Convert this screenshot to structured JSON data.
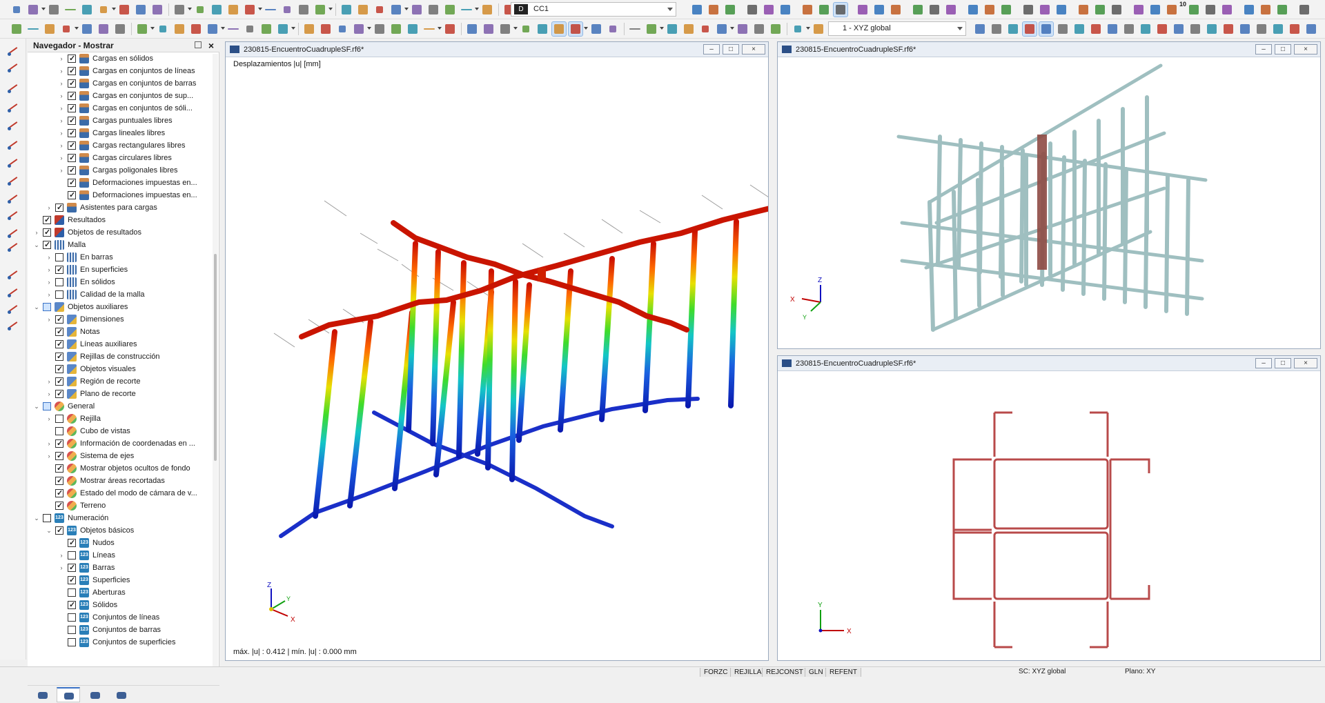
{
  "toolbar": {
    "design_situation_badge": "D",
    "load_case": "CC1",
    "coordinate_system": "1 - XYZ global",
    "scale_label": "10"
  },
  "navigator": {
    "title": "Navegador - Mostrar",
    "items": [
      {
        "label": "Cargas en sólidos",
        "level": 3,
        "checked": true,
        "icon": "load",
        "expander": true
      },
      {
        "label": "Cargas en conjuntos de líneas",
        "level": 3,
        "checked": true,
        "icon": "load",
        "expander": true
      },
      {
        "label": "Cargas en conjuntos de barras",
        "level": 3,
        "checked": true,
        "icon": "load",
        "expander": true
      },
      {
        "label": "Cargas en conjuntos de sup...",
        "level": 3,
        "checked": true,
        "icon": "load",
        "expander": true
      },
      {
        "label": "Cargas en conjuntos de sóli...",
        "level": 3,
        "checked": true,
        "icon": "load",
        "expander": true
      },
      {
        "label": "Cargas puntuales libres",
        "level": 3,
        "checked": true,
        "icon": "load",
        "expander": true
      },
      {
        "label": "Cargas lineales libres",
        "level": 3,
        "checked": true,
        "icon": "load",
        "expander": true
      },
      {
        "label": "Cargas rectangulares libres",
        "level": 3,
        "checked": true,
        "icon": "load",
        "expander": true
      },
      {
        "label": "Cargas circulares libres",
        "level": 3,
        "checked": true,
        "icon": "load",
        "expander": true
      },
      {
        "label": "Cargas poligonales libres",
        "level": 3,
        "checked": true,
        "icon": "load",
        "expander": true
      },
      {
        "label": "Deformaciones impuestas en...",
        "level": 3,
        "checked": true,
        "icon": "load",
        "expander": false
      },
      {
        "label": "Deformaciones impuestas en...",
        "level": 3,
        "checked": true,
        "icon": "load",
        "expander": false
      },
      {
        "label": "Asistentes para cargas",
        "level": 2,
        "checked": true,
        "icon": "load",
        "expander": true
      },
      {
        "label": "Resultados",
        "level": 1,
        "checked": true,
        "icon": "res",
        "expander": false
      },
      {
        "label": "Objetos de resultados",
        "level": 1,
        "checked": true,
        "icon": "res",
        "expander": true
      },
      {
        "label": "Malla",
        "level": 1,
        "checked": true,
        "icon": "mesh",
        "expander": "open"
      },
      {
        "label": "En barras",
        "level": 2,
        "checked": false,
        "icon": "mesh",
        "expander": true
      },
      {
        "label": "En superficies",
        "level": 2,
        "checked": true,
        "icon": "mesh",
        "expander": true
      },
      {
        "label": "En sólidos",
        "level": 2,
        "checked": false,
        "icon": "mesh",
        "expander": true
      },
      {
        "label": "Calidad de la malla",
        "level": 2,
        "checked": false,
        "icon": "mesh",
        "expander": true
      },
      {
        "label": "Objetos auxiliares",
        "level": 1,
        "checked": "partial",
        "icon": "aux",
        "expander": "open"
      },
      {
        "label": "Dimensiones",
        "level": 2,
        "checked": true,
        "icon": "aux",
        "expander": true
      },
      {
        "label": "Notas",
        "level": 2,
        "checked": true,
        "icon": "aux",
        "expander": false
      },
      {
        "label": "Líneas auxiliares",
        "level": 2,
        "checked": true,
        "icon": "aux",
        "expander": false
      },
      {
        "label": "Rejillas de construcción",
        "level": 2,
        "checked": true,
        "icon": "aux",
        "expander": false
      },
      {
        "label": "Objetos visuales",
        "level": 2,
        "checked": true,
        "icon": "aux",
        "expander": false
      },
      {
        "label": "Región de recorte",
        "level": 2,
        "checked": true,
        "icon": "aux",
        "expander": true
      },
      {
        "label": "Plano de recorte",
        "level": 2,
        "checked": true,
        "icon": "aux",
        "expander": true
      },
      {
        "label": "General",
        "level": 1,
        "checked": "partial",
        "icon": "gen",
        "expander": "open"
      },
      {
        "label": "Rejilla",
        "level": 2,
        "checked": false,
        "icon": "gen",
        "expander": true
      },
      {
        "label": "Cubo de vistas",
        "level": 2,
        "checked": false,
        "icon": "gen",
        "expander": false
      },
      {
        "label": "Información de coordenadas en ...",
        "level": 2,
        "checked": true,
        "icon": "gen",
        "expander": true
      },
      {
        "label": "Sistema de ejes",
        "level": 2,
        "checked": true,
        "icon": "gen",
        "expander": true
      },
      {
        "label": "Mostrar objetos ocultos de fondo",
        "level": 2,
        "checked": true,
        "icon": "gen",
        "expander": false
      },
      {
        "label": "Mostrar áreas recortadas",
        "level": 2,
        "checked": true,
        "icon": "gen",
        "expander": false
      },
      {
        "label": "Estado del modo de cámara de v...",
        "level": 2,
        "checked": true,
        "icon": "gen",
        "expander": false
      },
      {
        "label": "Terreno",
        "level": 2,
        "checked": true,
        "icon": "gen",
        "expander": false
      },
      {
        "label": "Numeración",
        "level": 1,
        "checked": false,
        "icon": "num",
        "expander": "open"
      },
      {
        "label": "Objetos básicos",
        "level": 2,
        "checked": true,
        "icon": "num",
        "expander": "open"
      },
      {
        "label": "Nudos",
        "level": 3,
        "checked": true,
        "icon": "num",
        "expander": false
      },
      {
        "label": "Líneas",
        "level": 3,
        "checked": false,
        "icon": "num",
        "expander": true
      },
      {
        "label": "Barras",
        "level": 3,
        "checked": true,
        "icon": "num",
        "expander": true
      },
      {
        "label": "Superficies",
        "level": 3,
        "checked": true,
        "icon": "num",
        "expander": false
      },
      {
        "label": "Aberturas",
        "level": 3,
        "checked": false,
        "icon": "num",
        "expander": false
      },
      {
        "label": "Sólidos",
        "level": 3,
        "checked": true,
        "icon": "num",
        "expander": false
      },
      {
        "label": "Conjuntos de líneas",
        "level": 3,
        "checked": false,
        "icon": "num",
        "expander": false
      },
      {
        "label": "Conjuntos de barras",
        "level": 3,
        "checked": false,
        "icon": "num",
        "expander": false
      },
      {
        "label": "Conjuntos de superficies",
        "level": 3,
        "checked": false,
        "icon": "num",
        "expander": false
      }
    ]
  },
  "windows": {
    "main": {
      "title": "230815-EncuentroCuadrupleSF.rf6*",
      "result_label": "Desplazamientos |u| [mm]",
      "summary": "máx. |u| : 0.412 | mín. |u| : 0.000 mm"
    },
    "top_right": {
      "title": "230815-EncuentroCuadrupleSF.rf6*"
    },
    "bottom_right": {
      "title": "230815-EncuentroCuadrupleSF.rf6*"
    }
  },
  "axes": {
    "x": "X",
    "y": "Y",
    "z": "Z"
  },
  "status_bar": {
    "toggles": [
      "FORZC",
      "REJILLA",
      "REJCONST",
      "GLN",
      "REFENT"
    ],
    "coord_system": "SC: XYZ global",
    "plane": "Plano: XY"
  },
  "colors": {
    "accent": "#3a72c6",
    "frame_red": "#b84a4a",
    "frame_teal": "#a9c3c4"
  }
}
